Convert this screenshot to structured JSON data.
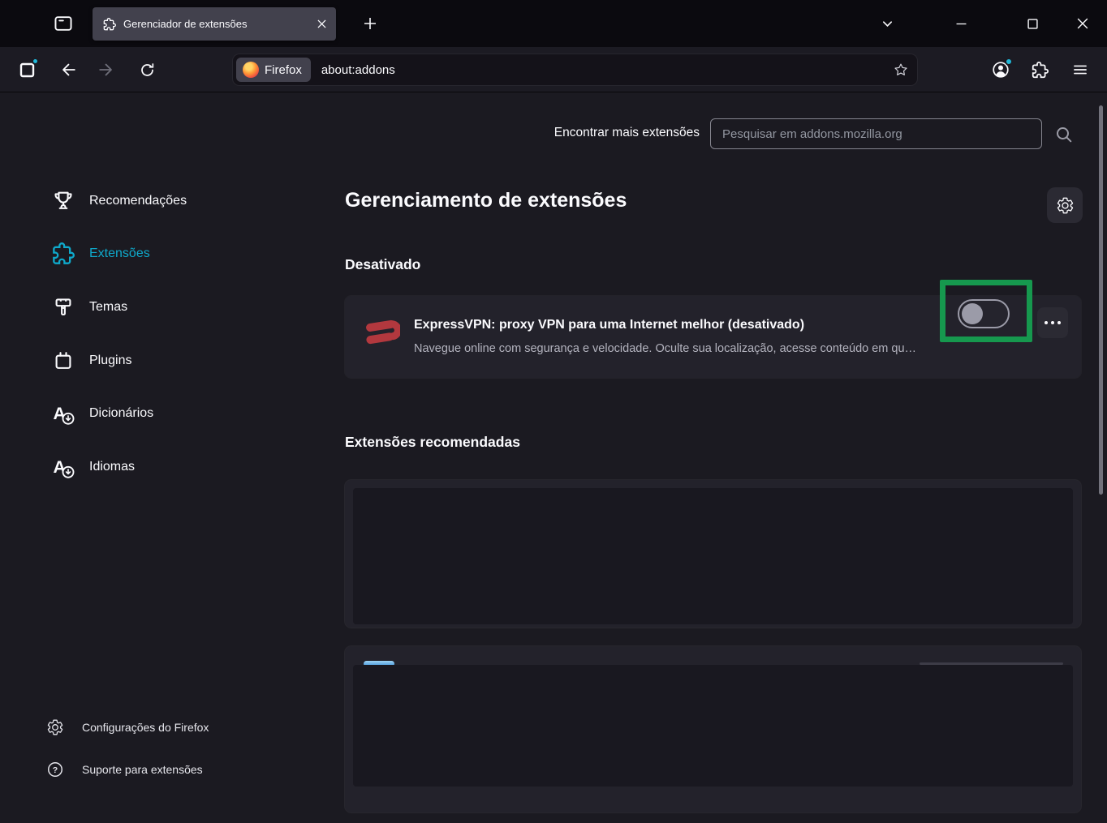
{
  "window": {
    "tab_title": "Gerenciador de extensões"
  },
  "toolbar": {
    "url_chip_label": "Firefox",
    "url": "about:addons"
  },
  "page": {
    "find_more_label": "Encontrar mais extensões",
    "search_placeholder": "Pesquisar em addons.mozilla.org",
    "title": "Gerenciamento de extensões",
    "sections": {
      "disabled_heading": "Desativado",
      "recommended_heading": "Extensões recomendadas"
    },
    "extension": {
      "name": "ExpressVPN: proxy VPN para uma Internet melhor (desativado)",
      "description": "Navegue online com segurança e velocidade. Oculte sua localização, acesse conteúdo em qu…",
      "toggle_state": "off"
    },
    "sidebar": {
      "items": [
        {
          "label": "Recomendações",
          "icon": "trophy-icon",
          "active": false
        },
        {
          "label": "Extensões",
          "icon": "puzzle-icon",
          "active": true
        },
        {
          "label": "Temas",
          "icon": "paintbrush-icon",
          "active": false
        },
        {
          "label": "Plugins",
          "icon": "plug-icon",
          "active": false
        },
        {
          "label": "Dicionários",
          "icon": "dictionary-download-icon",
          "active": false
        },
        {
          "label": "Idiomas",
          "icon": "language-download-icon",
          "active": false
        }
      ],
      "footer": [
        {
          "label": "Configurações do Firefox",
          "icon": "gear-icon"
        },
        {
          "label": "Suporte para extensões",
          "icon": "question-icon"
        }
      ]
    }
  },
  "colors": {
    "sidebar_active_accent": "#0fa9cb",
    "annotation_green": "#16984e",
    "expressvpn_red": "#b2383e",
    "notification_dot_teal": "#20b8d8"
  }
}
